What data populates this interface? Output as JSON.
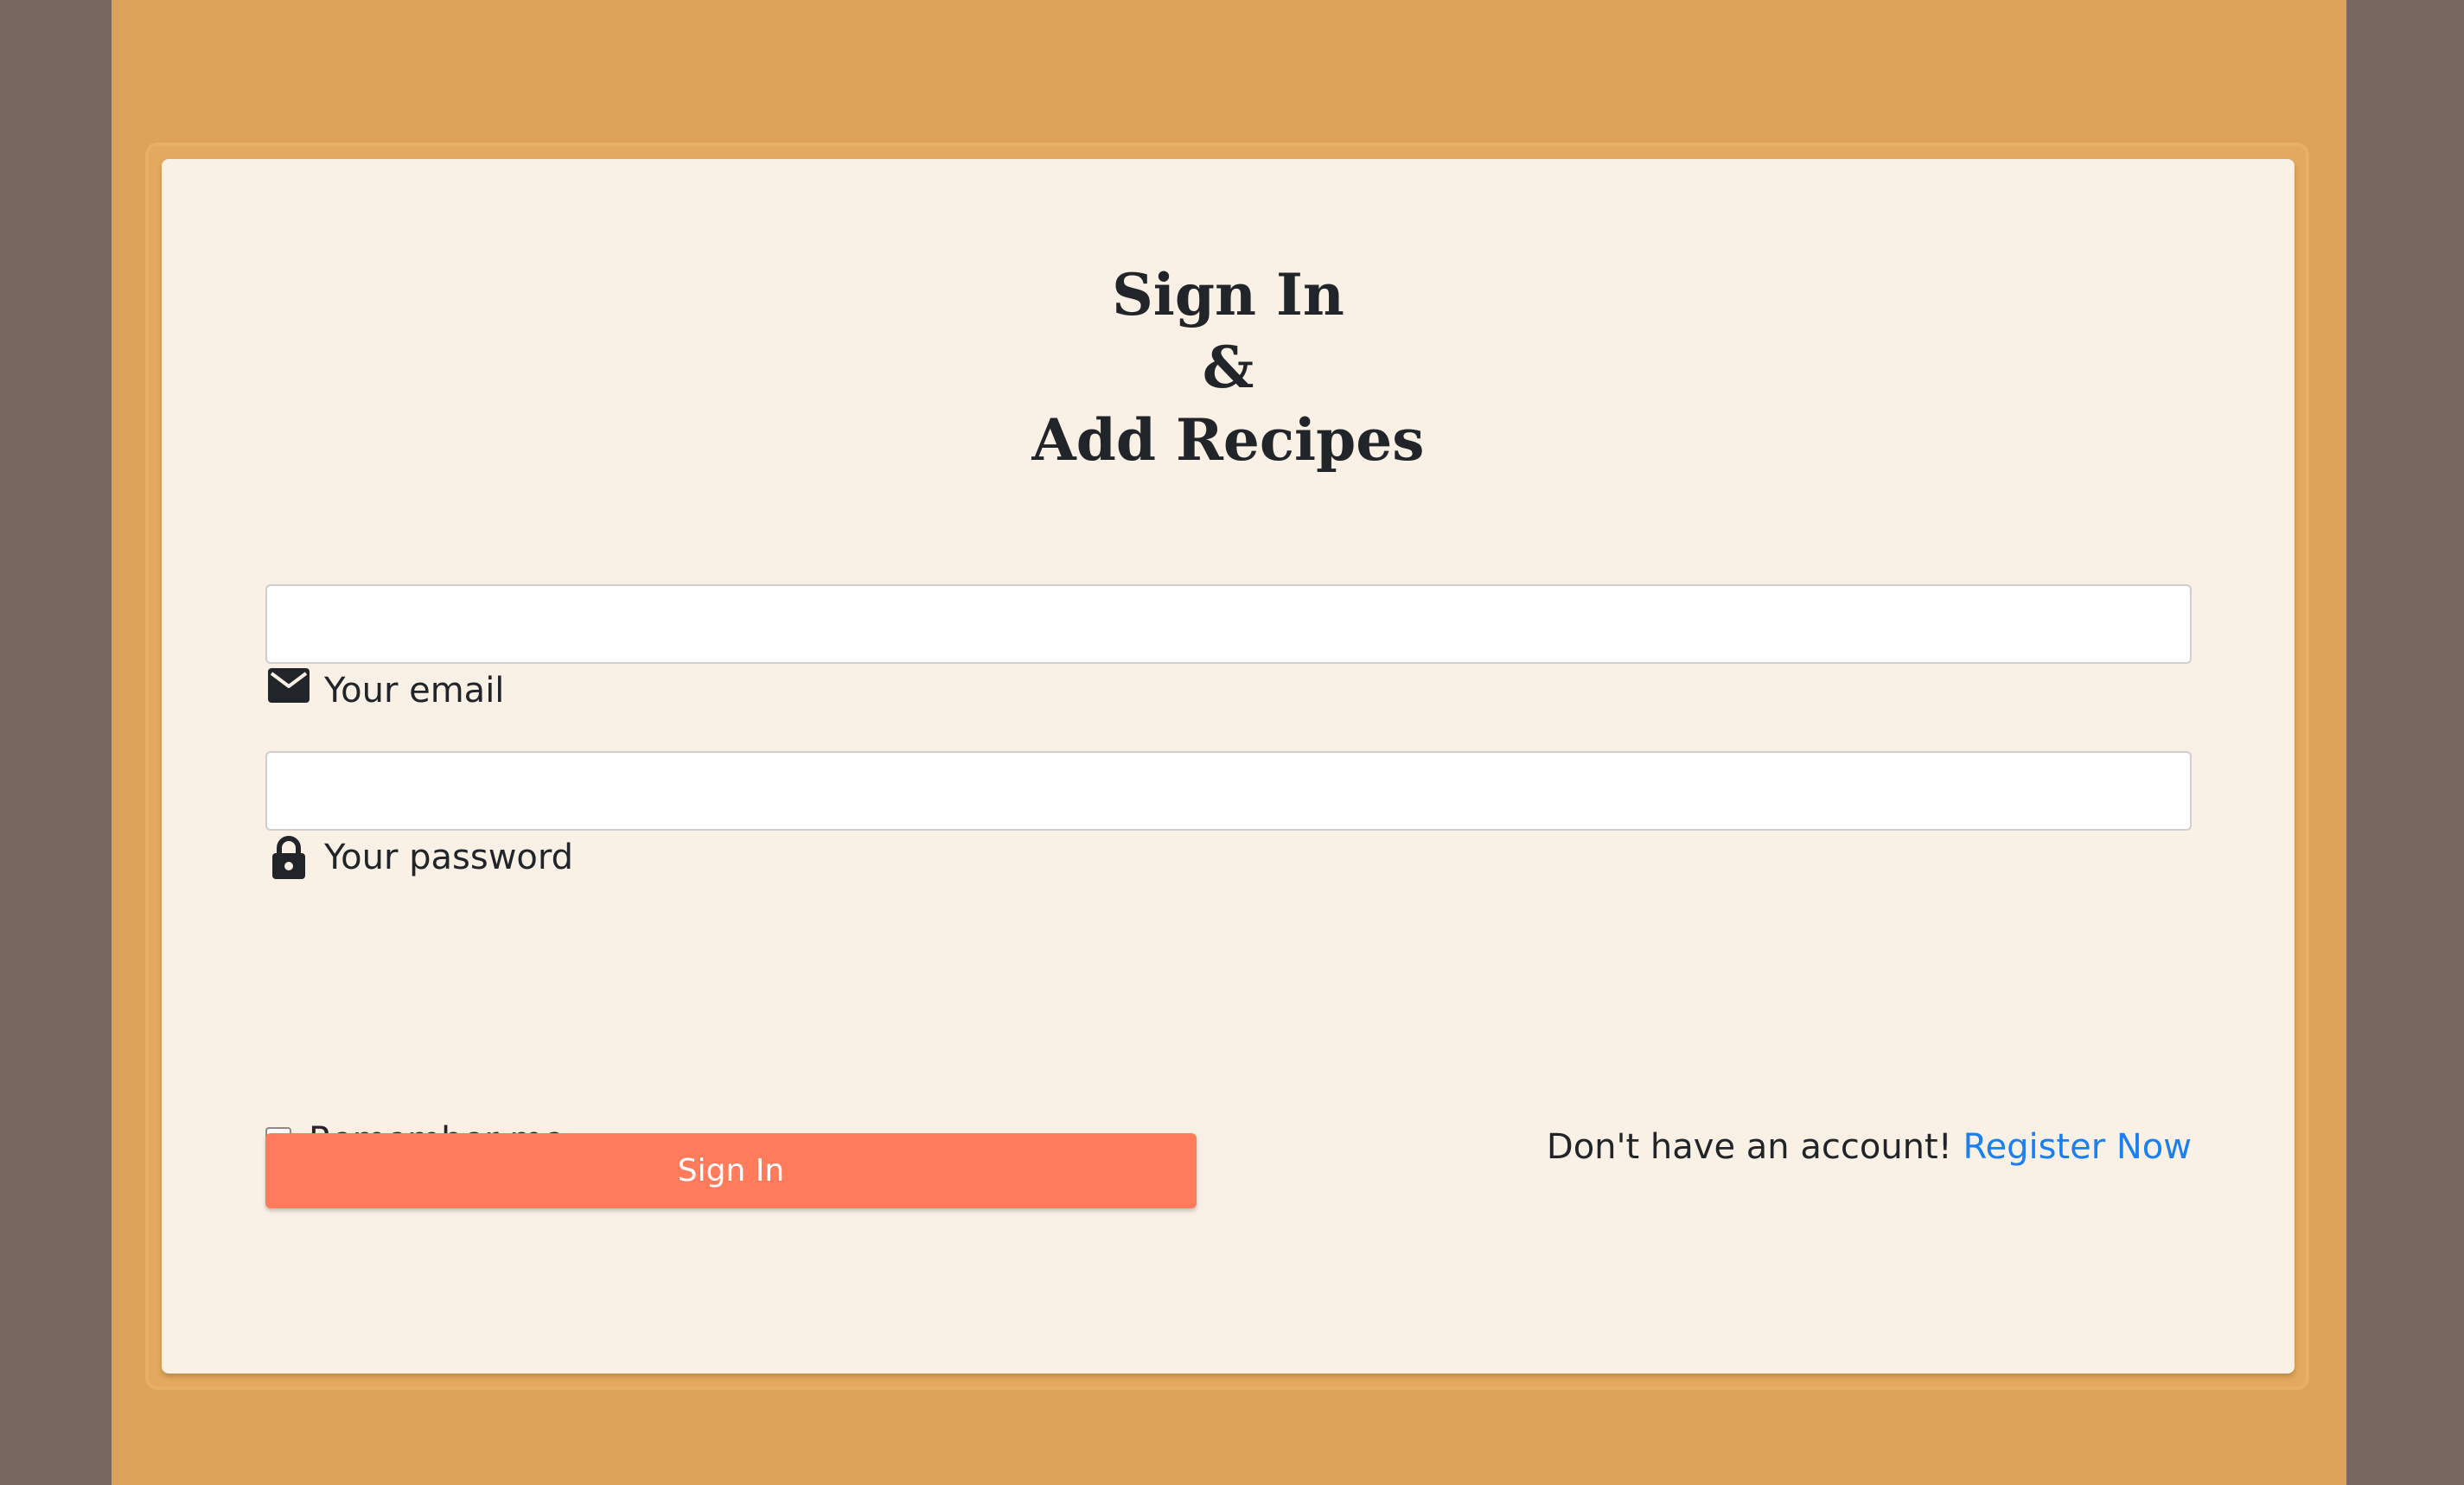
{
  "heading": {
    "line1": "Sign In",
    "line2": "&",
    "line3": "Add Recipes"
  },
  "email": {
    "value": "",
    "label": "Your email",
    "icon": "envelope-icon"
  },
  "password": {
    "value": "",
    "label": "Your password",
    "icon": "lock-icon"
  },
  "remember": {
    "label": "Remember me",
    "checked": false
  },
  "signin": {
    "label": "Sign In"
  },
  "register": {
    "prompt": "Don't have an account!",
    "link_label": "Register Now"
  },
  "colors": {
    "outer_background": "#786760",
    "page_background": "#dca259",
    "card_background": "#f9f0e6",
    "button": "#ff7b5c",
    "link": "#1a7ff0",
    "text": "#212529"
  }
}
